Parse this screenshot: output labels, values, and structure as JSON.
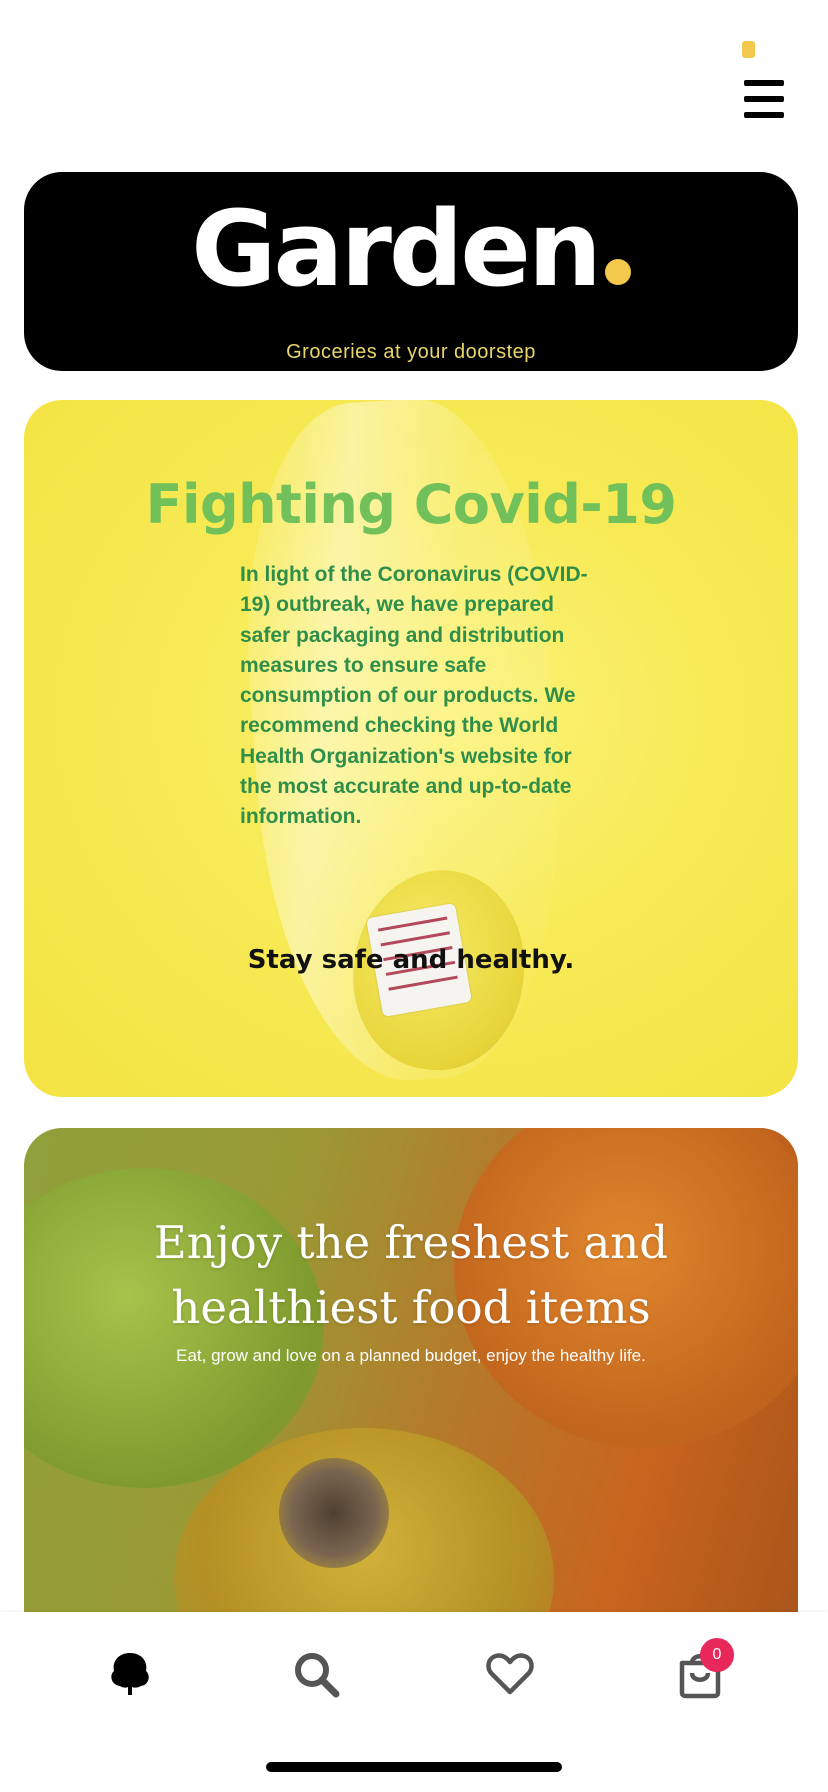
{
  "header": {
    "menu_icon": "hamburger-menu-icon",
    "status_indicator_color": "#f2c94c"
  },
  "hero": {
    "logo_text": "Garden",
    "tagline": "Groceries at your doorstep",
    "accent_color": "#f2c94c"
  },
  "covid_card": {
    "title": "Fighting Covid-19",
    "body": "In light of the Coronavirus (COVID-19) outbreak, we have prepared safer packaging and distribution measures to ensure safe consumption of our products. We recommend checking the World Health Organization's website for the most accurate and up-to-date information.",
    "closing": "Stay safe and healthy.",
    "title_color": "#72c05a",
    "body_color": "#2f8f4a"
  },
  "fresh_card": {
    "title_line1": "Enjoy the freshest and",
    "title_line2": "healthiest food items",
    "subtitle": "Eat, grow and love on a planned budget, enjoy the healthy life."
  },
  "bottom_nav": {
    "items": [
      {
        "icon": "tree-icon"
      },
      {
        "icon": "search-icon"
      },
      {
        "icon": "heart-icon"
      },
      {
        "icon": "shopping-bag-icon"
      }
    ],
    "cart_count": "0",
    "badge_color": "#e8275a"
  }
}
